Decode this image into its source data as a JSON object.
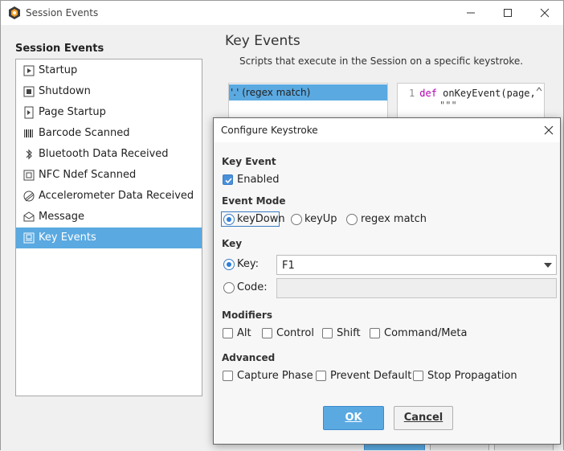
{
  "window": {
    "title": "Session Events",
    "app_icon": "ignition-app-icon",
    "controls": [
      "minimize-icon",
      "maximize-icon",
      "close-icon"
    ]
  },
  "sidebar": {
    "title": "Session Events",
    "items": [
      {
        "label": "Startup",
        "icon": "startup-icon"
      },
      {
        "label": "Shutdown",
        "icon": "shutdown-icon"
      },
      {
        "label": "Page Startup",
        "icon": "page-startup-icon"
      },
      {
        "label": "Barcode Scanned",
        "icon": "barcode-icon"
      },
      {
        "label": "Bluetooth Data Received",
        "icon": "bluetooth-icon"
      },
      {
        "label": "NFC Ndef Scanned",
        "icon": "nfc-icon"
      },
      {
        "label": "Accelerometer Data Received",
        "icon": "accelerometer-icon"
      },
      {
        "label": "Message",
        "icon": "message-icon"
      },
      {
        "label": "Key Events",
        "icon": "key-events-icon",
        "selected": true
      }
    ]
  },
  "main": {
    "title": "Key Events",
    "subtitle": "Scripts that execute in the Session on a specific keystroke.",
    "key_list": [
      "'.' (regex match)"
    ],
    "code": {
      "line_number": "1",
      "keyword": "def",
      "text": " onKeyEvent(page,",
      "line2": "\"\"\""
    }
  },
  "dialog": {
    "title": "Configure Keystroke",
    "key_event": {
      "label": "Key Event",
      "enabled_label": "Enabled",
      "enabled": true
    },
    "event_mode": {
      "label": "Event Mode",
      "options": [
        "keyDown",
        "keyUp",
        "regex match"
      ],
      "selected": "keyDown"
    },
    "key": {
      "label": "Key",
      "key_label": "Key:",
      "key_value": "F1",
      "code_label": "Code:",
      "code_value": "",
      "selected": "key"
    },
    "modifiers": {
      "label": "Modifiers",
      "options": [
        "Alt",
        "Control",
        "Shift",
        "Command/Meta"
      ]
    },
    "advanced": {
      "label": "Advanced",
      "options": [
        "Capture Phase",
        "Prevent Default",
        "Stop Propagation"
      ]
    },
    "ok_label": "OK",
    "cancel_label": "Cancel"
  },
  "colors": {
    "accent": "#5aa9e1",
    "selection": "#5aa9e1",
    "keyword": "#b000b0"
  }
}
